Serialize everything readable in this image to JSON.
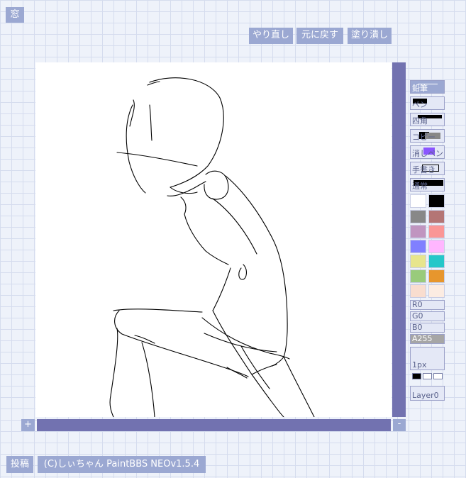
{
  "window_button": "窓",
  "toolbar": {
    "redo": "やり直し",
    "undo": "元に戻す",
    "fill_clear": "塗り潰し"
  },
  "canvas": {
    "zoom_in": "+",
    "zoom_out": "-"
  },
  "tools": [
    {
      "label": "鉛筆",
      "selected": true
    },
    {
      "label": "ペン",
      "selected": false
    },
    {
      "label": "四角",
      "selected": false
    },
    {
      "label": "コピー",
      "selected": false
    },
    {
      "label": "消しペン",
      "selected": false
    },
    {
      "label": "手書き",
      "selected": false
    },
    {
      "label": "通常",
      "selected": false
    }
  ],
  "palette": [
    "#ffffff",
    "#000000",
    "#888888",
    "#b47575",
    "#c095c0",
    "#fa9696",
    "#8080ff",
    "#ffb6ff",
    "#e7e58d",
    "#25c7c9",
    "#99cb7b",
    "#e7962d",
    "#f9ddcf",
    "#fcece2"
  ],
  "sliders": {
    "r": "R0",
    "g": "G0",
    "b": "B0",
    "a": "A255"
  },
  "brush_size": "1px",
  "layer": "Layer0",
  "footer": {
    "post": "投稿",
    "credit": "(C)しぃちゃん PaintBBS NEOv1.5.4"
  },
  "colors": {
    "accent": "#9ba8d2",
    "scrollbar": "#7272b0",
    "selected_color": "#000000"
  }
}
